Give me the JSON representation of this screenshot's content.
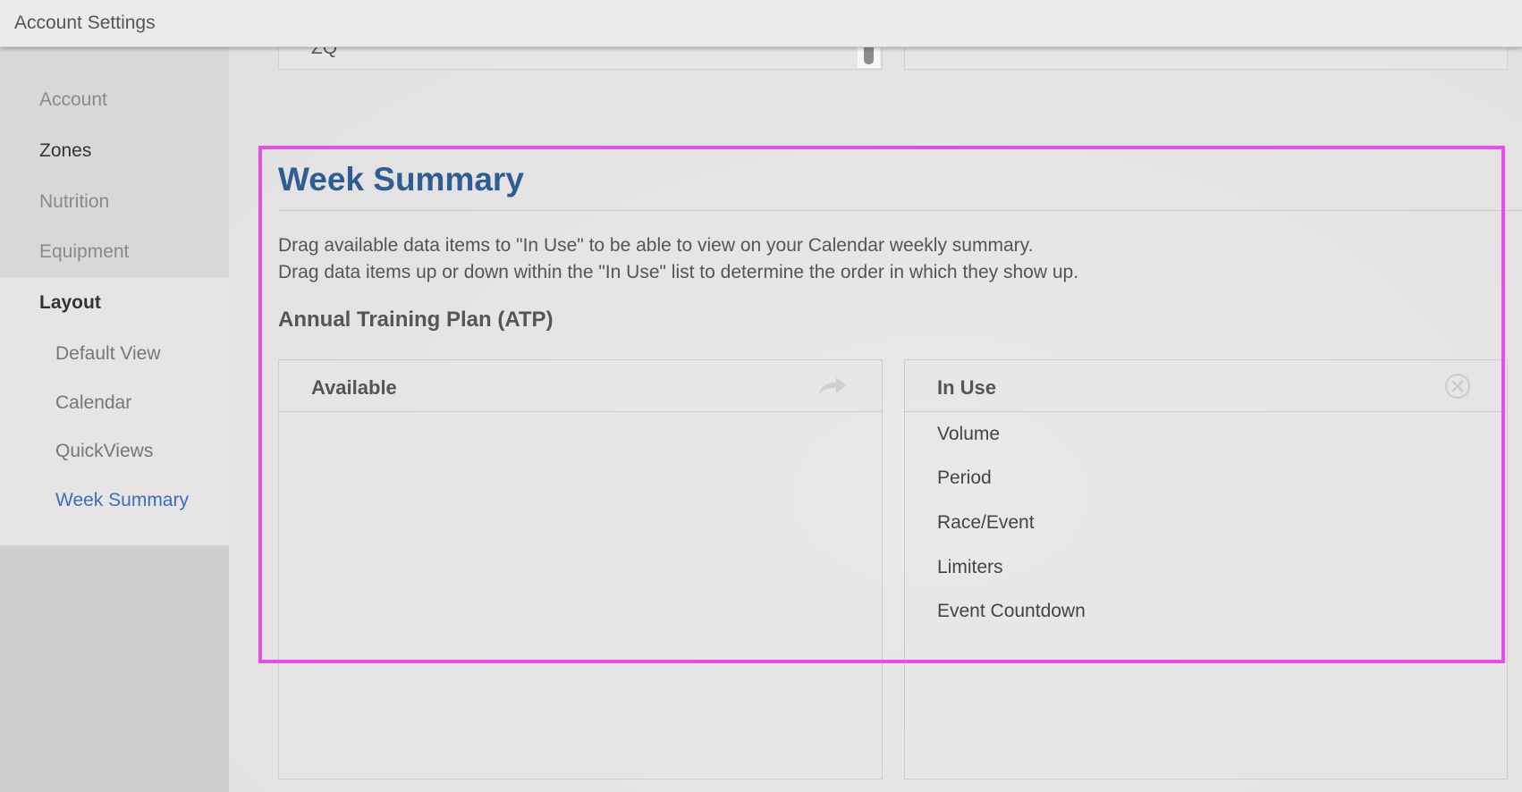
{
  "window": {
    "title": "Account Settings"
  },
  "sidebar": {
    "items": [
      {
        "label": "Account"
      },
      {
        "label": "Zones"
      },
      {
        "label": "Nutrition"
      },
      {
        "label": "Equipment"
      },
      {
        "label": "Layout"
      }
    ],
    "layout_sub_items": [
      {
        "label": "Default View"
      },
      {
        "label": "Calendar"
      },
      {
        "label": "QuickViews"
      },
      {
        "label": "Week Summary"
      }
    ]
  },
  "top_partial": {
    "left_text": "ZQ"
  },
  "week_summary": {
    "title": "Week Summary",
    "description_line1": "Drag available data items to \"In Use\" to be able to view on your Calendar weekly summary.",
    "description_line2": "Drag data items up or down within the \"In Use\" list to determine the order in which they show up.",
    "section_heading": "Annual Training Plan (ATP)",
    "available": {
      "label": "Available",
      "icon": "arrow-forward-icon",
      "items": []
    },
    "in_use": {
      "label": "In Use",
      "icon": "clear-circle-icon",
      "items": [
        "Volume",
        "Period",
        "Race/Event",
        "Limiters",
        "Event Countdown"
      ]
    }
  },
  "colors": {
    "title_blue": "#2f5c92",
    "active_link_blue": "#3d6eb4",
    "highlight_magenta": "#e64ee8"
  }
}
